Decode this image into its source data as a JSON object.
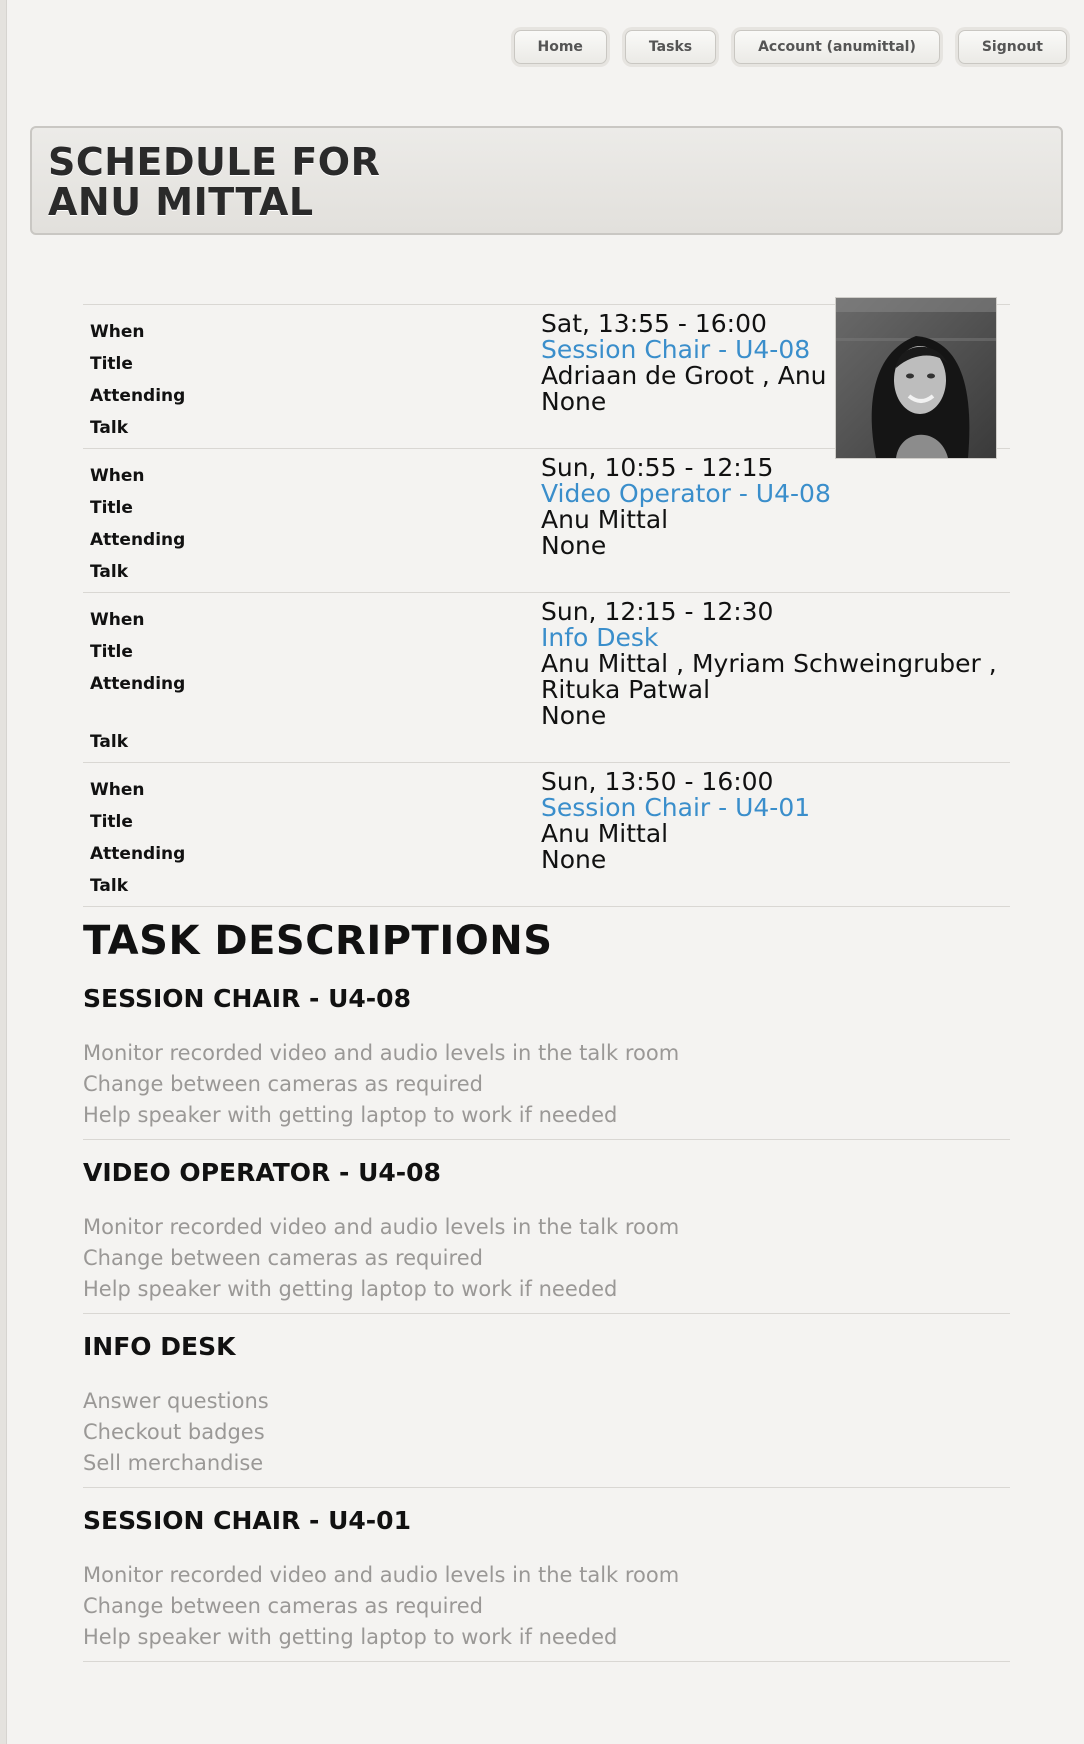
{
  "nav": {
    "home": "Home",
    "tasks": "Tasks",
    "account": "Account (anumittal)",
    "signout": "Signout"
  },
  "header": {
    "line1": "SCHEDULE FOR",
    "line2": "ANU MITTAL"
  },
  "labels": {
    "when": "When",
    "title": "Title",
    "attending": "Attending",
    "talk": "Talk"
  },
  "schedule": [
    {
      "when": "Sat, 13:55 - 16:00",
      "title": "Session Chair - U4-08",
      "attending": "Adriaan de Groot , Anu Mittal",
      "talk": "None"
    },
    {
      "when": "Sun, 10:55 - 12:15",
      "title": "Video Operator - U4-08",
      "attending": "Anu Mittal",
      "talk": "None"
    },
    {
      "when": "Sun, 12:15 - 12:30",
      "title": "Info Desk",
      "attending": "Anu Mittal , Myriam Schweingruber , Rituka Patwal",
      "talk": "None"
    },
    {
      "when": "Sun, 13:50 - 16:00",
      "title": "Session Chair - U4-01",
      "attending": "Anu Mittal",
      "talk": "None"
    }
  ],
  "task_descriptions": {
    "title": "TASK DESCRIPTIONS",
    "items": [
      {
        "heading": "SESSION CHAIR - U4-08",
        "lines": [
          "Monitor recorded video and audio levels in the talk room",
          "Change between cameras as required",
          "Help speaker with getting laptop to work if needed"
        ]
      },
      {
        "heading": "VIDEO OPERATOR - U4-08",
        "lines": [
          "Monitor recorded video and audio levels in the talk room",
          "Change between cameras as required",
          "Help speaker with getting laptop to work if needed"
        ]
      },
      {
        "heading": "INFO DESK",
        "lines": [
          "Answer questions",
          "Checkout badges",
          "Sell merchandise"
        ]
      },
      {
        "heading": "SESSION CHAIR - U4-01",
        "lines": [
          "Monitor recorded video and audio levels in the talk room",
          "Change between cameras as required",
          "Help speaker with getting laptop to work if needed"
        ]
      }
    ]
  },
  "colors": {
    "link": "#3a8ecb",
    "muted_text": "#9a9896",
    "background": "#f4f3f1"
  }
}
